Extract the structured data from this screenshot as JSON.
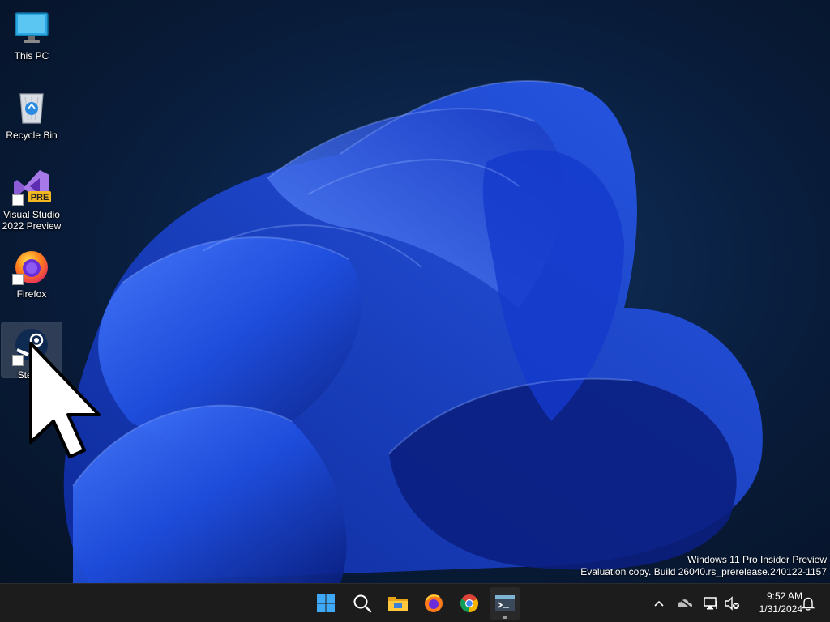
{
  "desktop": {
    "icons": [
      {
        "label": "This PC",
        "icon": "monitor-icon"
      },
      {
        "label": "Recycle Bin",
        "icon": "recycle-bin-icon"
      },
      {
        "label": "Visual Studio\n2022 Preview",
        "icon": "visual-studio-icon",
        "badge": "PRE"
      },
      {
        "label": "Firefox",
        "icon": "firefox-icon"
      },
      {
        "label": "Steam",
        "icon": "steam-icon",
        "selected": true
      }
    ],
    "watermark": {
      "line1": "Windows 11 Pro Insider Preview",
      "line2": "Evaluation copy. Build 26040.rs_prerelease.240122-1157"
    }
  },
  "taskbar": {
    "pinned": [
      {
        "name": "start",
        "icon": "windows-logo-icon"
      },
      {
        "name": "search",
        "icon": "search-icon"
      },
      {
        "name": "file-explorer",
        "icon": "folder-icon"
      },
      {
        "name": "firefox",
        "icon": "firefox-icon"
      },
      {
        "name": "chrome",
        "icon": "chrome-icon"
      },
      {
        "name": "terminal",
        "icon": "terminal-icon",
        "running": true
      }
    ],
    "tray": {
      "icons": [
        "chevron-up-icon",
        "cloud-offline-icon",
        "network-icon",
        "volume-muted-icon",
        "bell-icon"
      ],
      "time": "9:52 AM",
      "date": "1/31/2024"
    }
  },
  "colors": {
    "taskbar": "#1c1c1c",
    "wallpaper_dark": "#081a36",
    "bloom_blue": "#1f4fe0"
  }
}
